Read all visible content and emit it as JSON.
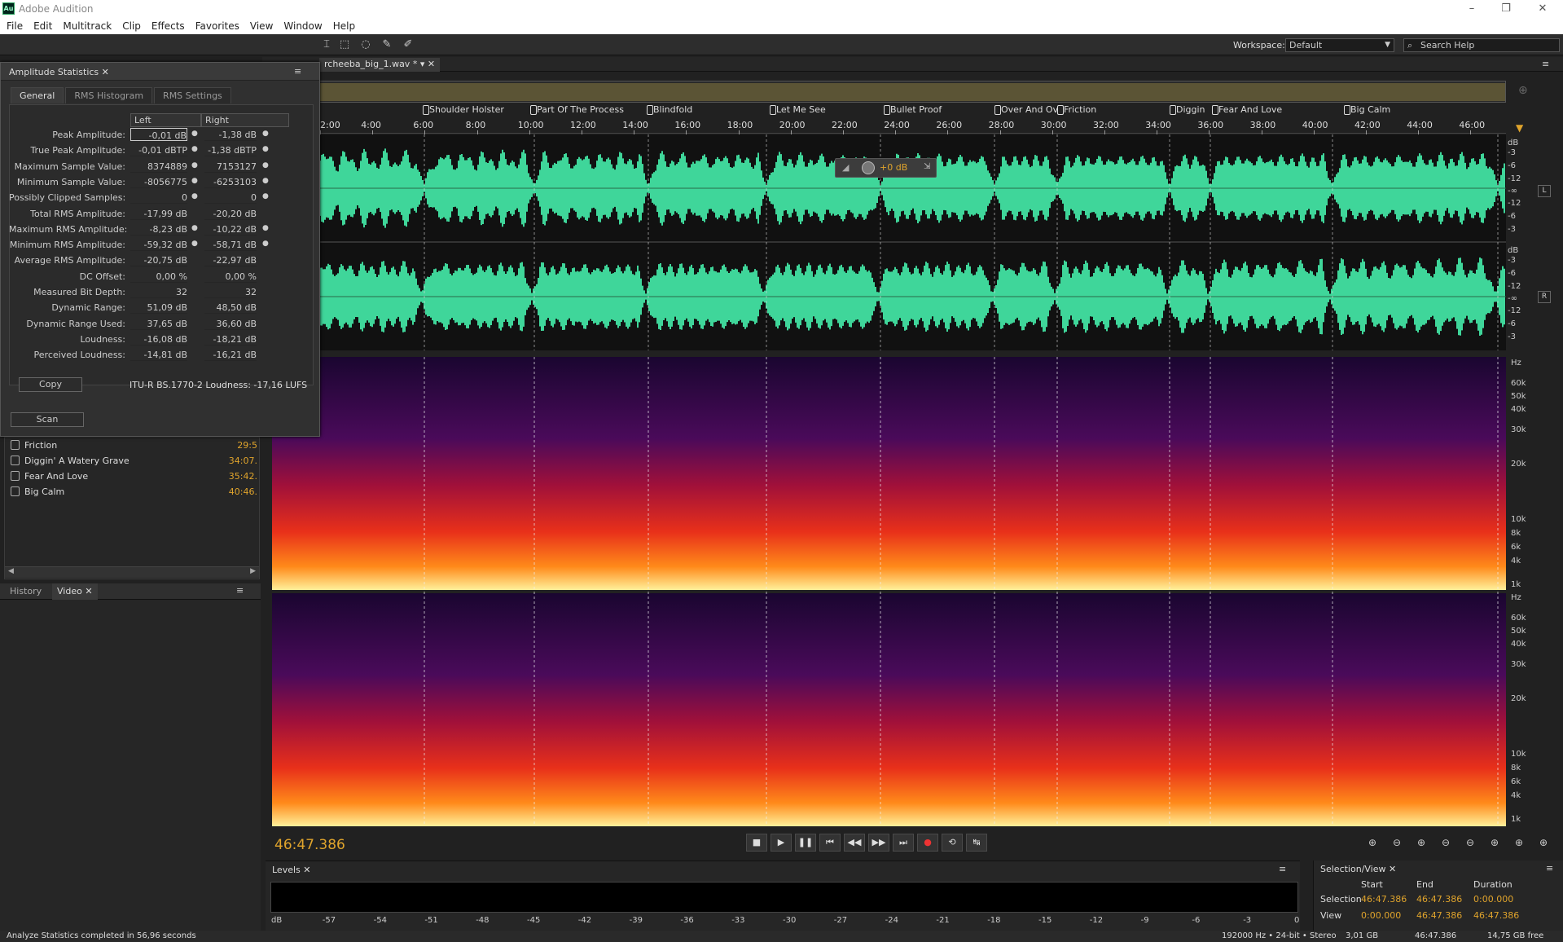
{
  "app": {
    "title": "Adobe Audition",
    "logo": "Au"
  },
  "menu": [
    "File",
    "Edit",
    "Multitrack",
    "Clip",
    "Effects",
    "Favorites",
    "View",
    "Window",
    "Help"
  ],
  "toolbar": {
    "workspace_label": "Workspace:",
    "workspace_value": "Default",
    "search_placeholder": "Search Help"
  },
  "amp": {
    "title": "Amplitude Statistics",
    "tabs": [
      "General",
      "RMS Histogram",
      "RMS Settings"
    ],
    "col_left": "Left",
    "col_right": "Right",
    "rows": [
      {
        "label": "Peak Amplitude:",
        "left": "-0,01 dB",
        "right": "-1,38 dB"
      },
      {
        "label": "True Peak Amplitude:",
        "left": "-0,01 dBTP",
        "right": "-1,38 dBTP"
      },
      {
        "label": "Maximum Sample Value:",
        "left": "8374889",
        "right": "7153127"
      },
      {
        "label": "Minimum Sample Value:",
        "left": "-8056775",
        "right": "-6253103"
      },
      {
        "label": "Possibly Clipped Samples:",
        "left": "0",
        "right": "0"
      },
      {
        "label": "Total RMS Amplitude:",
        "left": "-17,99 dB",
        "right": "-20,20 dB"
      },
      {
        "label": "Maximum RMS Amplitude:",
        "left": "-8,23 dB",
        "right": "-10,22 dB"
      },
      {
        "label": "Minimum RMS Amplitude:",
        "left": "-59,32 dB",
        "right": "-58,71 dB"
      },
      {
        "label": "Average RMS Amplitude:",
        "left": "-20,75 dB",
        "right": "-22,97 dB"
      },
      {
        "label": "DC Offset:",
        "left": "0,00 %",
        "right": "0,00 %"
      },
      {
        "label": "Measured Bit Depth:",
        "left": "32",
        "right": "32"
      },
      {
        "label": "Dynamic Range:",
        "left": "51,09 dB",
        "right": "48,50 dB"
      },
      {
        "label": "Dynamic Range Used:",
        "left": "37,65 dB",
        "right": "36,60 dB"
      },
      {
        "label": "Loudness:",
        "left": "-16,08 dB",
        "right": "-18,21 dB"
      },
      {
        "label": "Perceived Loudness:",
        "left": "-14,81 dB",
        "right": "-16,21 dB"
      }
    ],
    "copy": "Copy",
    "itu": "ITU-R BS.1770-2 Loudness: -17,16 LUFS",
    "scan": "Scan"
  },
  "markers_list": [
    {
      "name": "Friction",
      "time": "29:5"
    },
    {
      "name": "Diggin' A Watery Grave",
      "time": "34:07."
    },
    {
      "name": "Fear And Love",
      "time": "35:42."
    },
    {
      "name": "Big Calm",
      "time": "40:46."
    }
  ],
  "left_tabs": [
    "History",
    "Video"
  ],
  "editor": {
    "file_tab": "rcheeba_big_1.wav *",
    "markers": [
      "Shoulder Holster",
      "Part Of The Process",
      "Blindfold",
      "Let Me See",
      "Bullet Proof",
      "Over And Ov",
      "Friction",
      "Diggin",
      "Fear And Love",
      "Big Calm"
    ],
    "ruler": [
      "2:00",
      "4:00",
      "6:00",
      "8:00",
      "10:00",
      "12:00",
      "14:00",
      "16:00",
      "18:00",
      "20:00",
      "22:00",
      "24:00",
      "26:00",
      "28:00",
      "30:00",
      "32:00",
      "34:00",
      "36:00",
      "38:00",
      "40:00",
      "42:00",
      "44:00",
      "46:00"
    ],
    "db_scale": [
      "dB",
      "-3",
      "-6",
      "-12",
      "-∞",
      "-12",
      "-6",
      "-3"
    ],
    "hz_scale": [
      "Hz",
      "60k",
      "50k",
      "40k",
      "30k",
      "20k",
      "10k",
      "8k",
      "6k",
      "4k",
      "1k"
    ],
    "channels": [
      "L",
      "R"
    ],
    "hud_value": "+0 dB"
  },
  "transport": {
    "time": "46:47.386"
  },
  "levels": {
    "title": "Levels",
    "ticks": [
      "dB",
      "-57",
      "-54",
      "-51",
      "-48",
      "-45",
      "-42",
      "-39",
      "-36",
      "-33",
      "-30",
      "-27",
      "-24",
      "-21",
      "-18",
      "-15",
      "-12",
      "-9",
      "-6",
      "-3",
      "0"
    ]
  },
  "selview": {
    "title": "Selection/View",
    "h_start": "Start",
    "h_end": "End",
    "h_dur": "Duration",
    "sel_label": "Selection",
    "sel_start": "46:47.386",
    "sel_end": "46:47.386",
    "sel_dur": "0:00.000",
    "view_label": "View",
    "view_start": "0:00.000",
    "view_end": "46:47.386",
    "view_dur": "46:47.386"
  },
  "status": {
    "message": "Analyze Statistics completed in 56,96 seconds",
    "format": "192000 Hz • 24-bit • Stereo",
    "size": "3,01 GB",
    "duration": "46:47.386",
    "free": "14,75 GB free"
  }
}
